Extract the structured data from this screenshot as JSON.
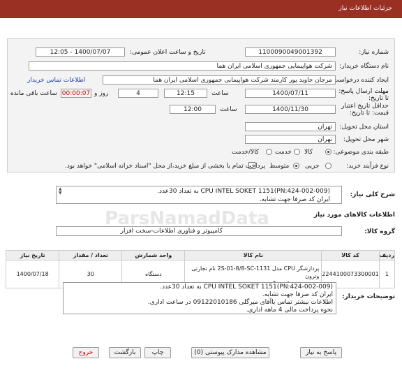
{
  "header": {
    "title": "جزئیات اطلاعات نیاز"
  },
  "form": {
    "need_number_label": "شماره نیاز:",
    "need_number": "1100090049001392",
    "announce_label": "تاریخ و ساعت اعلان عمومی:",
    "announce_value": "1400/07/07 - 12:05",
    "buyer_label": "نام دستگاه خریدار:",
    "buyer_value": "شرکت هواپیمایی جمهوری اسلامی ایران هما",
    "creator_label": "ایجاد کننده درخواست:",
    "creator_value": "مرجان جاوید پور کارمند شرکت هواپیمایی جمهوری اسلامی ایران هما",
    "contact_link": "اطلاعات تماس خریدار",
    "deadline_label": "مهلت ارسال پاسخ: تا تاریخ:",
    "deadline_date": "1400/07/11",
    "time_word": "ساعت",
    "deadline_time": "12:15",
    "days_value": "4",
    "days_label": "روز و",
    "remaining_time": "00:00:07",
    "remaining_label": "ساعت باقی مانده",
    "validity_label": "حداقل تاریخ اعتبار قیمت: تا تاریخ:",
    "validity_date": "1400/11/30",
    "validity_time": "12:00",
    "province_label": "استان محل تحویل:",
    "province_value": "تهران",
    "city_label": "شهر محل تحویل:",
    "city_value": "تهران",
    "category_label": "طبقه بندی موضوعی:",
    "category_options": [
      "کالا",
      "خدمت",
      "کالا/خدمت"
    ],
    "process_label": "نوع فرآیند خرید:",
    "process_options": [
      "جزیی",
      "متوسط"
    ],
    "payment_note": "پرداخت تمام یا بخشی از مبلغ خرید،از محل \"اسناد خزانه اسلامی\" خواهد بود."
  },
  "general_desc": {
    "label": "شرح کلی نیاز:",
    "line1": "CPU INTEL SOKET 1151(PN:424-002-009) به تعداد 30عدد.",
    "line2": "ایران کد صرفا جهت تشابه."
  },
  "goods_section": {
    "title": "اطلاعات کالاهای مورد نیاز"
  },
  "group": {
    "label": "گروه کالا:",
    "value": "کامپیوتر و فناوری اطلاعات-سخت افزار"
  },
  "table": {
    "headers": [
      "ردیف",
      "کد کالا",
      "نام کالا",
      "واحد شمارش",
      "تعداد / مقدار",
      "تاریخ نیاز"
    ],
    "rows": [
      {
        "row": "1",
        "code": "2244100073300001",
        "name_line1": "پردازشگر CPU مدل 1131-2S-01-8/8-SC نام تجارتی وترون",
        "name_line2": "مرجع عرضه کننده گروه بهمن",
        "unit": "دستگاه",
        "qty": "30",
        "date": "1400/07/18"
      }
    ]
  },
  "buyer_notes": {
    "label": "توضیحات خریدار:",
    "lines": [
      "CPU INTEL SOKET 1151(PN:424-002-009) به تعداد 30عدد.",
      "ایران کد صرفا جهت تشابه.",
      "اطلاعات بیشتر تماس باآقای میرگلی 09122010186 در ساعت اداری.",
      "نحوه پرداخت مالی 4 ماهه اداری."
    ]
  },
  "buttons": {
    "reply": "پاسخ به نیاز",
    "attachments": "مشاهده مدارک پیوستی (0)",
    "print": "چاپ",
    "back": "بازگشت",
    "exit": "خروج"
  }
}
